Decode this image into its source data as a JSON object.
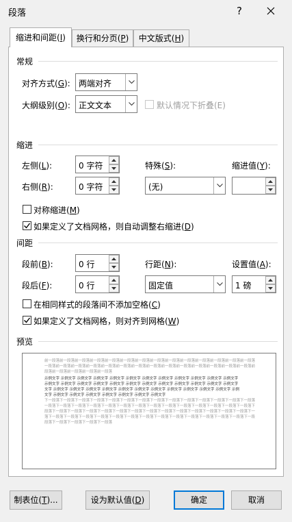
{
  "window": {
    "title": "段落",
    "help": "?",
    "close": "✕"
  },
  "tabs": [
    {
      "label": "缩进和间距(I)",
      "key": "I"
    },
    {
      "label": "换行和分页(P)",
      "key": "P"
    },
    {
      "label": "中文版式(H)",
      "key": "H"
    }
  ],
  "general": {
    "section": "常规",
    "alignment_label": "对齐方式(G):",
    "alignment_value": "两端对齐",
    "outline_label": "大纲级别(O):",
    "outline_value": "正文文本",
    "collapse_label": "默认情况下折叠(E)"
  },
  "indent": {
    "section": "缩进",
    "left_label": "左侧(L):",
    "left_value": "0 字符",
    "right_label": "右侧(R):",
    "right_value": "0 字符",
    "special_label": "特殊(S):",
    "special_value": "(无)",
    "by_label": "缩进值(Y):",
    "by_value": "",
    "mirror_label": "对称缩进(M)",
    "mirror_checked": false,
    "auto_right_label": "如果定义了文档网格，则自动调整右缩进(D)",
    "auto_right_checked": true
  },
  "spacing": {
    "section": "间距",
    "before_label": "段前(B):",
    "before_value": "0 行",
    "after_label": "段后(F):",
    "after_value": "0 行",
    "line_label": "行距(N):",
    "line_value": "固定值",
    "at_label": "设置值(A):",
    "at_value": "1 磅",
    "no_space_label": "在相同样式的段落间不添加空格(C)",
    "no_space_checked": false,
    "snap_grid_label": "如果定义了文档网格，则对齐到网格(W)",
    "snap_grid_checked": true
  },
  "preview": {
    "section": "预览",
    "lines": [
      {
        "text": "前一段落前一段落前一段落前一段落前一段落前一段落前一段落前一段落前一段落前一段落前一段落前一段落前一段落前一段落",
        "tone": "gray"
      },
      {
        "text": "一段落前一段落前一段落前一段落前一段落前一段落前一段落前一段落前一段落前一段落前一段落前一段落前一段落前一段落前",
        "tone": "gray"
      },
      {
        "text": "段落前一段落前一段落前一段落前一段落",
        "tone": "gray"
      },
      {
        "text": "示例文字 示例文字 示例文字 示例文字 示例文字 示例文字 示例文字 示例文字 示例文字 示例文字 示例文字 示例文字",
        "tone": "dark"
      },
      {
        "text": "示例文字 示例文字 示例文字 示例文字 示例文字 示例文字 示例文字 示例文字 示例文字 示例文字 示例文字 示例文字",
        "tone": "dark"
      },
      {
        "text": "文字 示例文字 示例文字 示例文字 示例文字 示例文字 示例文字 示例文字 示例文字 示例文字 示例文字 示例文字 示例",
        "tone": "dark"
      },
      {
        "text": "文字 示例文字 示例文字 示例文字 示例文字 示例文字 示例文字 示例文字",
        "tone": "dark"
      },
      {
        "text": "下一段落下一段落下一段落下一段落下一段落下一段落下一段落下一段落下一段落下一段落下一段落下一段落下一段落下一段落",
        "tone": "gray"
      },
      {
        "text": "一段落下一段落下一段落下一段落下一段落下一段落下一段落下一段落下一段落下一段落下一段落下一段落下一段落下一段落下",
        "tone": "gray"
      },
      {
        "text": "段落下一段落下一段落下一段落下一段落下一段落下一段落下一段落下一段落下一段落下一段落下一段落下一段落下一段落下一",
        "tone": "gray"
      },
      {
        "text": "落下一段落下一段落下一段落下一段落下一段落下一段落下一段落下一段落下一段落下一段落下一段落下一段落下一段落下一段",
        "tone": "gray"
      },
      {
        "text": "段落下一段落下一段落下一段落下一段落",
        "tone": "gray"
      }
    ]
  },
  "buttons": {
    "tabs": "制表位(T)...",
    "set_default": "设为默认值(D)",
    "ok": "确定",
    "cancel": "取消"
  },
  "colors": {
    "accent": "#0078d7",
    "face": "#f0f0f0",
    "border": "#adadad"
  }
}
